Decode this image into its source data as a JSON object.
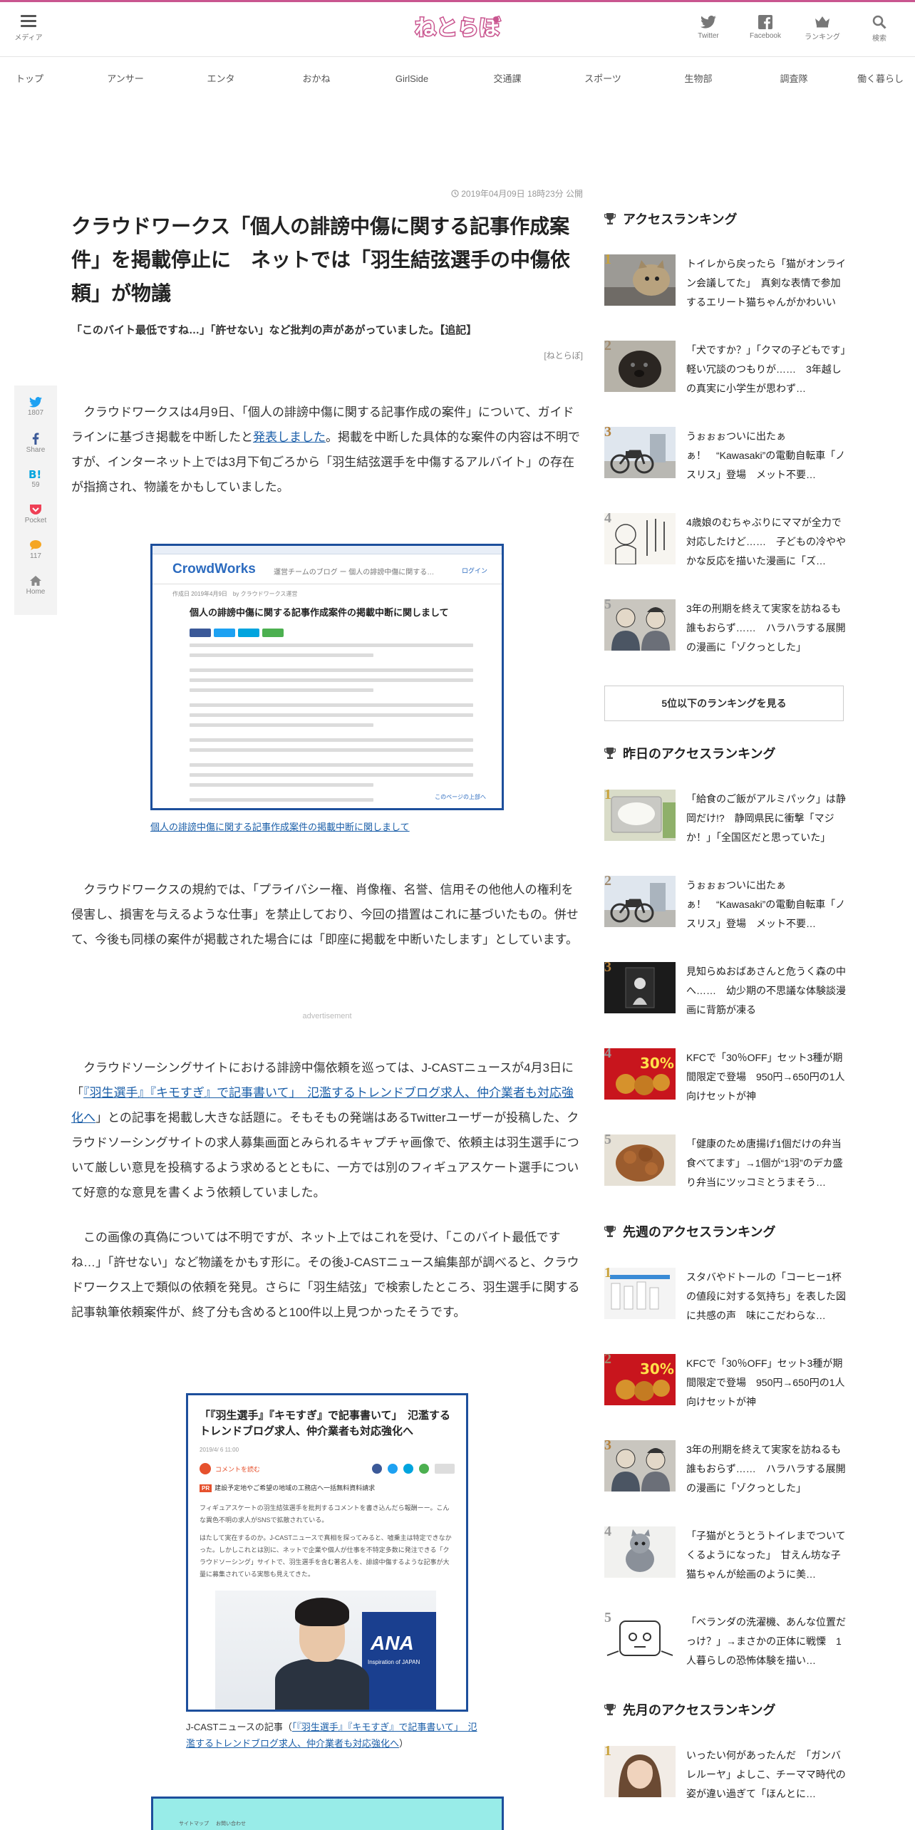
{
  "header": {
    "menu_label": "メディア",
    "logo_text": "ねとらぼ",
    "icons": [
      {
        "name": "twitter-icon",
        "label": "Twitter"
      },
      {
        "name": "facebook-icon",
        "label": "Facebook"
      },
      {
        "name": "crown-icon",
        "label": "ランキング"
      },
      {
        "name": "search-icon",
        "label": "検索"
      }
    ]
  },
  "nav": [
    "トップ",
    "アンサー",
    "エンタ",
    "おかね",
    "GirlSide",
    "交通課",
    "スポーツ",
    "生物部",
    "調査隊",
    "働く暮らし"
  ],
  "share": {
    "twitter_count": "1807",
    "share_label": "Share",
    "hatena_count": "59",
    "pocket_label": "Pocket",
    "comment_count": "117",
    "home_label": "Home"
  },
  "article": {
    "date": "2019年04月09日 18時23分 公開",
    "title": "クラウドワークス「個人の誹謗中傷に関する記事作成案件」を掲載停止に　ネットでは「羽生結弦選手の中傷依頼」が物議",
    "subtitle": "「このバイト最低ですね…」「許せない」など批判の声があがっていました。【追記】",
    "credit": "[ねとらぼ]",
    "p1_a": "クラウドワークスは4月9日、「個人の誹謗中傷に関する記事作成の案件」について、ガイドラインに基づき掲載を中断したと",
    "p1_link": "発表しました",
    "p1_b": "。掲載を中断した具体的な案件の内容は不明ですが、インターネット上では3月下旬ごろから「羽生結弦選手を中傷するアルバイト」の存在が指摘され、物議をかもしていました。",
    "figure1": {
      "logo": "CrowdWorks",
      "header_sub": "運営チームのブログ ー 個人の誹謗中傷に関する…",
      "login": "ログイン",
      "meta": "作成日 2019年4月9日　by クラウドワークス運営",
      "title": "個人の誹謗中傷に関する記事作成案件の掲載中断に関しまして",
      "footer": "このページの上部へ",
      "caption": "個人の誹謗中傷に関する記事作成案件の掲載中断に関しまして"
    },
    "p2": "クラウドワークスの規約では、「プライバシー権、肖像権、名誉、信用その他他人の権利を侵害し、損害を与えるような仕事」を禁止しており、今回の措置はこれに基づいたもの。併せて、今後も同様の案件が掲載された場合には「即座に掲載を中断いたします」としています。",
    "ad_label": "advertisement",
    "p3_a": "クラウドソーシングサイトにおける誹謗中傷依頼を巡っては、J-CASTニュースが4月3日に「",
    "p3_link": "『羽生選手』『キモすぎ』で記事書いて」　氾濫するトレンドブログ求人、仲介業者も対応強化へ",
    "p3_b": "」との記事を掲載し大きな話題に。そもそもの発端はあるTwitterユーザーが投稿した、クラウドソーシングサイトの求人募集画面とみられるキャプチャ画像で、依頼主は羽生選手について厳しい意見を投稿するよう求めるとともに、一方では別のフィギュアスケート選手について好意的な意見を書くよう依頼していました。",
    "p4": "この画像の真偽については不明ですが、ネット上ではこれを受け、「このバイト最低ですね…」「許せない」など物議をかもす形に。その後J-CASTニュース編集部が調べると、クラウドワークス上で類似の依頼を発見。さらに「羽生結弦」で検索したところ、羽生選手に関する記事執筆依頼案件が、終了分も含めると100件以上見つかったそうです。",
    "figure2": {
      "title": "「『羽生選手』『キモすぎ』で記事書いて」　氾濫するトレンドブログ求人、仲介業者も対応強化へ",
      "date": "2019/4/ 6 11:00",
      "comment": "コメントを読む",
      "tag_label": "PR",
      "tag_text": "建設予定地やご希望の地域の工務店へ一括無料資料請求",
      "body1": "フィギュアスケートの羽生結弦選手を批判するコメントを書き込んだら報酬ーー。こんな異色不明の求人がSNSで拡散されている。",
      "body2": "はたして実在するのか。J-CASTニュースで真相を探ってみると、嘘乗主は特定できなかった。しかしこれとは別に、ネットで企業や個人が仕事を不特定多数に発注できる「クラウドソーシング」サイトで、羽生選手を含む著名人を、誹謗中傷するような記事が大量に募集されている実態も見えてきた。",
      "photo_text": "ANA",
      "photo_sub": "Inspiration of JAPAN",
      "caption_prefix": "J-CASTニュースの記事（",
      "caption_link": "「『羽生選手』『キモすぎ』で記事書いて」　氾濫するトレンドブログ求人、仲介業者も対応強化へ",
      "caption_suffix": "）"
    },
    "figure3": {
      "item1": "サイトマップ",
      "item2": "お問い合わせ"
    }
  },
  "sidebar": {
    "access_heading": "アクセスランキング",
    "access": [
      {
        "num": "1",
        "text": "トイレから戻ったら「猫がオンライン会議してた」　真剣な表情で参加するエリート猫ちゃんがかわいい"
      },
      {
        "num": "2",
        "text": "「犬ですか？」「クマの子どもです」　軽い冗談のつもりが……　3年越しの真実に小学生が思わず…"
      },
      {
        "num": "3",
        "text": "うぉぉぉついに出たぁぁ！　“Kawasaki”の電動自転車「ノスリス」登場　メット不要…"
      },
      {
        "num": "4",
        "text": "4歳娘のむちゃぶりにママが全力で対応したけど……　子どもの冷ややかな反応を描いた漫画に「ズ…"
      },
      {
        "num": "5",
        "text": "3年の刑期を終えて実家を訪ねるも誰もおらず……　ハラハラする展開の漫画に「ゾクっとした」"
      }
    ],
    "more_label": "5位以下のランキングを見る",
    "yesterday_heading": "昨日のアクセスランキング",
    "yesterday": [
      {
        "num": "1",
        "text": "「給食のご飯がアルミパック」は静岡だけ!?　静岡県民に衝撃「マジか！」「全国区だと思っていた」"
      },
      {
        "num": "2",
        "text": "うぉぉぉついに出たぁぁ！　“Kawasaki”の電動自転車「ノスリス」登場　メット不要…"
      },
      {
        "num": "3",
        "text": "見知らぬおばあさんと危うく森の中へ……　幼少期の不思議な体験談漫画に背筋が凍る"
      },
      {
        "num": "4",
        "text": "KFCで「30％OFF」セット3種が期間限定で登場　950円→650円の1人向けセットが神"
      },
      {
        "num": "5",
        "text": "「健康のため唐揚げ1個だけの弁当食べてます」→1個が“1羽”のデカ盛り弁当にツッコミとうまそう…"
      }
    ],
    "lastweek_heading": "先週のアクセスランキング",
    "lastweek": [
      {
        "num": "1",
        "text": "スタバやドトールの「コーヒー1杯の値段に対する気持ち」を表した図に共感の声　味にこだわらな…"
      },
      {
        "num": "2",
        "text": "KFCで「30％OFF」セット3種が期間限定で登場　950円→650円の1人向けセットが神"
      },
      {
        "num": "3",
        "text": "3年の刑期を終えて実家を訪ねるも誰もおらず……　ハラハラする展開の漫画に「ゾクっとした」"
      },
      {
        "num": "4",
        "text": "「子猫がとうとうトイレまでついてくるようになった」　甘えん坊な子猫ちゃんが絵画のように美…"
      },
      {
        "num": "5",
        "text": "「ベランダの洗濯機、あんな位置だっけ？」→まさかの正体に戦慄　1人暮らしの恐怖体験を描い…"
      }
    ],
    "lastmonth_heading": "先月のアクセスランキング",
    "lastmonth": [
      {
        "num": "1",
        "text": "いったい何があったんだ　「ガンバレルーヤ」よしこ、チーママ時代の姿が違い過ぎて「ほんとに…"
      }
    ],
    "kfc_badge": "30%"
  },
  "colors": {
    "brand": "#c9558f",
    "link": "#1a5ea8",
    "figure_border": "#1d4f9c"
  }
}
